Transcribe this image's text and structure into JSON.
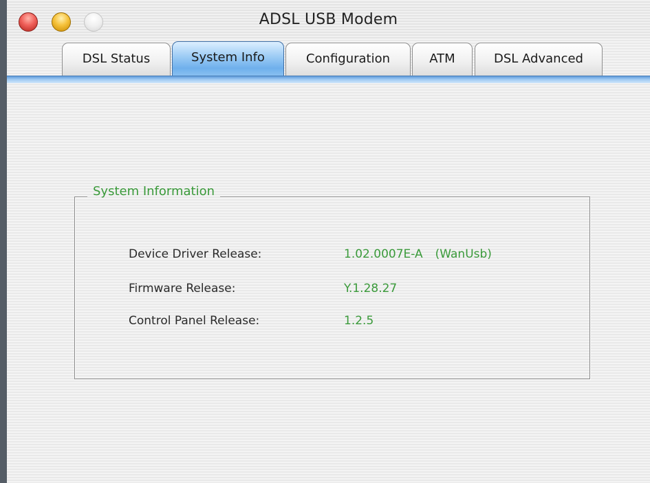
{
  "window": {
    "title": "ADSL USB Modem"
  },
  "tabs": [
    {
      "label": "DSL Status",
      "active": false
    },
    {
      "label": "System Info",
      "active": true
    },
    {
      "label": "Configuration",
      "active": false
    },
    {
      "label": "ATM",
      "active": false
    },
    {
      "label": "DSL Advanced",
      "active": false
    }
  ],
  "system_info": {
    "group_title": "System Information",
    "rows": [
      {
        "label": "Device Driver Release:",
        "value": "1.02.0007E-A",
        "extra": "(WanUsb)"
      },
      {
        "label": "Firmware Release:",
        "value": "Y.1.28.27"
      },
      {
        "label": "Control Panel Release:",
        "value": "1.2.5"
      }
    ]
  },
  "colors": {
    "value_text": "#3a9a3a",
    "active_tab": "#6fb0ec",
    "close_button": "#f0605a",
    "minimize_button": "#f6c23c"
  }
}
